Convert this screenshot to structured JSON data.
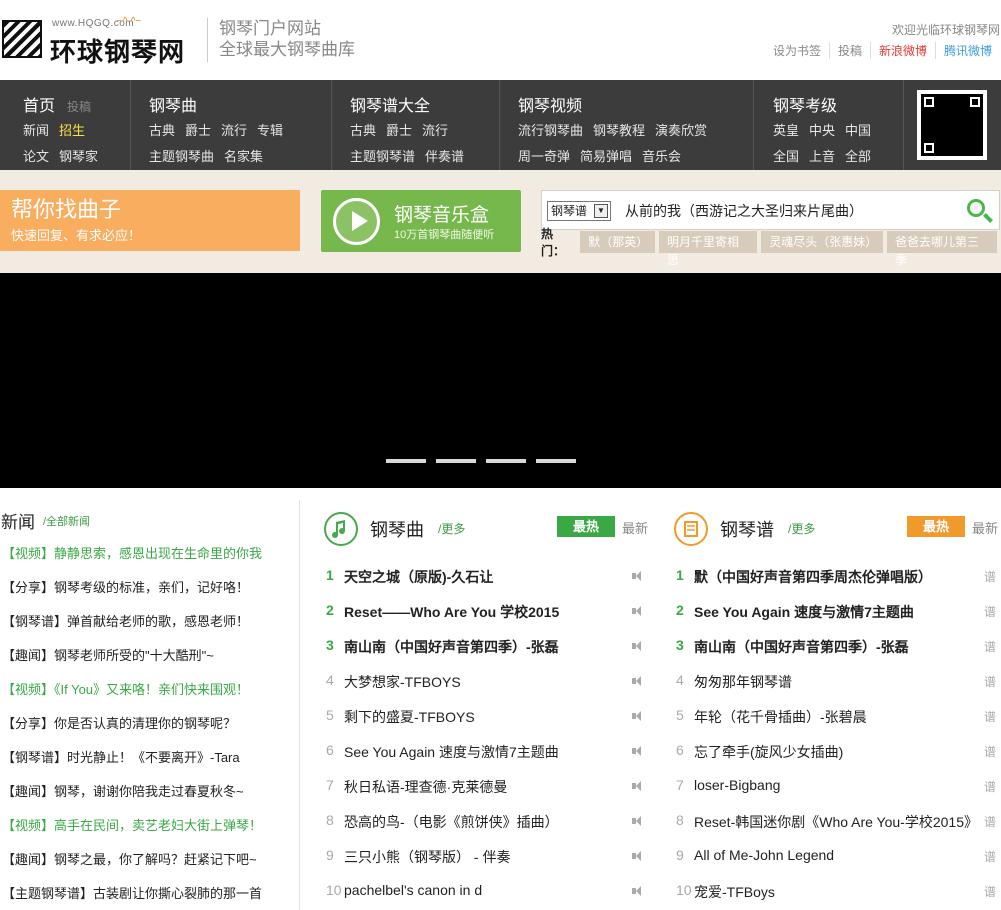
{
  "header": {
    "url": "www.HQGQ.com",
    "smile": "~^-^~",
    "site_name": "环球钢琴网",
    "slogan1": "钢琴门户网站",
    "slogan2": "全球最大钢琴曲库",
    "welcome": "欢迎光临环球钢琴网",
    "links": [
      "设为书签",
      "投稿",
      "新浪微博",
      "腾讯微博"
    ]
  },
  "nav": {
    "home": {
      "title": "首页",
      "sub": "投稿",
      "r1": [
        "新闻",
        "招生"
      ],
      "r2": [
        "论文",
        "钢琴家"
      ]
    },
    "qu": {
      "title": "钢琴曲",
      "r1": [
        "古典",
        "爵士",
        "流行",
        "专辑"
      ],
      "r2": [
        "主题钢琴曲",
        "名家集"
      ]
    },
    "pu": {
      "title": "钢琴谱大全",
      "r1": [
        "古典",
        "爵士",
        "流行"
      ],
      "r2": [
        "主题钢琴谱",
        "伴奏谱"
      ]
    },
    "video": {
      "title": "钢琴视频",
      "r1": [
        "流行钢琴曲",
        "钢琴教程",
        "演奏欣赏"
      ],
      "r2": [
        "周一奇弹",
        "简易弹唱",
        "音乐会"
      ]
    },
    "grade": {
      "title": "钢琴考级",
      "r1": [
        "英皇",
        "中央",
        "中国"
      ],
      "r2": [
        "全国",
        "上音",
        "全部"
      ]
    }
  },
  "promo": {
    "find_title": "帮你找曲子",
    "find_sub": "快速回复、有求必应！",
    "box_title": "钢琴音乐盒",
    "box_sub": "10万首钢琴曲随便听"
  },
  "search": {
    "select": "钢琴谱",
    "value": "从前的我（西游记之大圣归来片尾曲）",
    "hot_label": "热门：",
    "hot": [
      "默（那英）",
      "明月千里寄相思",
      "灵魂尽头（张惠妹）",
      "爸爸去哪儿第三季"
    ]
  },
  "news": {
    "title": "新闻",
    "more": "/全部新闻",
    "items": [
      {
        "text": "【视频】静静思索，感恩出现在生命里的你我",
        "green": true
      },
      {
        "text": "【分享】钢琴考级的标准，亲们，记好咯！",
        "green": false
      },
      {
        "text": "【钢琴谱】弹首献给老师的歌，感恩老师！",
        "green": false
      },
      {
        "text": "【趣闻】钢琴老师所受的\"十大酷刑\"~",
        "green": false
      },
      {
        "text": "【视频】《If You》又来咯！亲们快来围观！",
        "green": true
      },
      {
        "text": "【分享】你是否认真的清理你的钢琴呢？",
        "green": false
      },
      {
        "text": "【钢琴谱】时光静止！《不要离开》-Tara",
        "green": false
      },
      {
        "text": "【趣闻】钢琴，谢谢你陪我走过春夏秋冬~",
        "green": false
      },
      {
        "text": "【视频】高手在民间，卖艺老妇大街上弹琴！",
        "green": true
      },
      {
        "text": "【趣闻】钢琴之最，你了解吗？赶紧记下吧~",
        "green": false
      },
      {
        "text": "【主题钢琴谱】古装剧让你撕心裂肺的那一首",
        "green": false
      }
    ]
  },
  "qu_list": {
    "title": "钢琴曲",
    "more": "/更多",
    "hot": "最热",
    "new": "最新",
    "color": "#3aa845",
    "items": [
      {
        "n": "1",
        "t": "天空之城（原版)-久石让"
      },
      {
        "n": "2",
        "t": "Reset——Who Are You 学校2015"
      },
      {
        "n": "3",
        "t": "南山南（中国好声音第四季）-张磊"
      },
      {
        "n": "4",
        "t": "大梦想家-TFBOYS"
      },
      {
        "n": "5",
        "t": "剩下的盛夏-TFBOYS"
      },
      {
        "n": "6",
        "t": "See You Again 速度与激情7主题曲"
      },
      {
        "n": "7",
        "t": "秋日私语-理查德·克莱德曼"
      },
      {
        "n": "8",
        "t": "恐高的鸟-（电影《煎饼侠》插曲）"
      },
      {
        "n": "9",
        "t": " 三只小熊（钢琴版） - 伴奏"
      },
      {
        "n": "10",
        "t": "pachelbel's canon in d"
      }
    ]
  },
  "pu_list": {
    "title": "钢琴谱",
    "more": "/更多",
    "hot": "最热",
    "new": "最新",
    "color": "#f09a2c",
    "mark": "谱",
    "items": [
      {
        "n": "1",
        "t": "默（中国好声音第四季周杰伦弹唱版）"
      },
      {
        "n": "2",
        "t": "See You Again 速度与激情7主题曲"
      },
      {
        "n": "3",
        "t": "南山南（中国好声音第四季）-张磊"
      },
      {
        "n": "4",
        "t": "匆匆那年钢琴谱"
      },
      {
        "n": "5",
        "t": "年轮（花千骨插曲）-张碧晨"
      },
      {
        "n": "6",
        "t": "忘了牵手(旋风少女插曲)"
      },
      {
        "n": "7",
        "t": "loser-Bigbang"
      },
      {
        "n": "8",
        "t": "Reset-韩国迷你剧《Who Are You-学校2015》"
      },
      {
        "n": "9",
        "t": "All of Me-John Legend"
      },
      {
        "n": "10",
        "t": "宠爱-TFBoys"
      }
    ]
  }
}
